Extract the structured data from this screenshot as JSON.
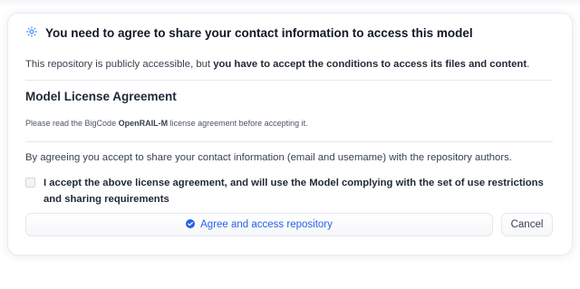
{
  "dialog": {
    "title": "You need to agree to share your contact information to access this model",
    "title_icon": "gated-model-icon",
    "intro_plain": "This repository is publicly accessible, but ",
    "intro_bold": "you have to accept the conditions to access its files and content",
    "intro_end": "."
  },
  "license": {
    "heading": "Model License Agreement",
    "note_prefix": "Please read the BigCode ",
    "note_bold": "OpenRAIL-M",
    "note_suffix": " license agreement before accepting it."
  },
  "consent": {
    "text": "By agreeing you accept to share your contact information (email and usemame) with the repository authors.",
    "checkbox_label": "I accept the above license agreement, and will use the Model complying with the set of use restrictions and sharing requirements",
    "checkbox_checked": false
  },
  "actions": {
    "agree_label": "Agree and access repository",
    "agree_icon": "check-circle-icon",
    "cancel_label": "Cancel"
  },
  "colors": {
    "accent": "#2563eb",
    "title_icon": "#3b82f6"
  }
}
